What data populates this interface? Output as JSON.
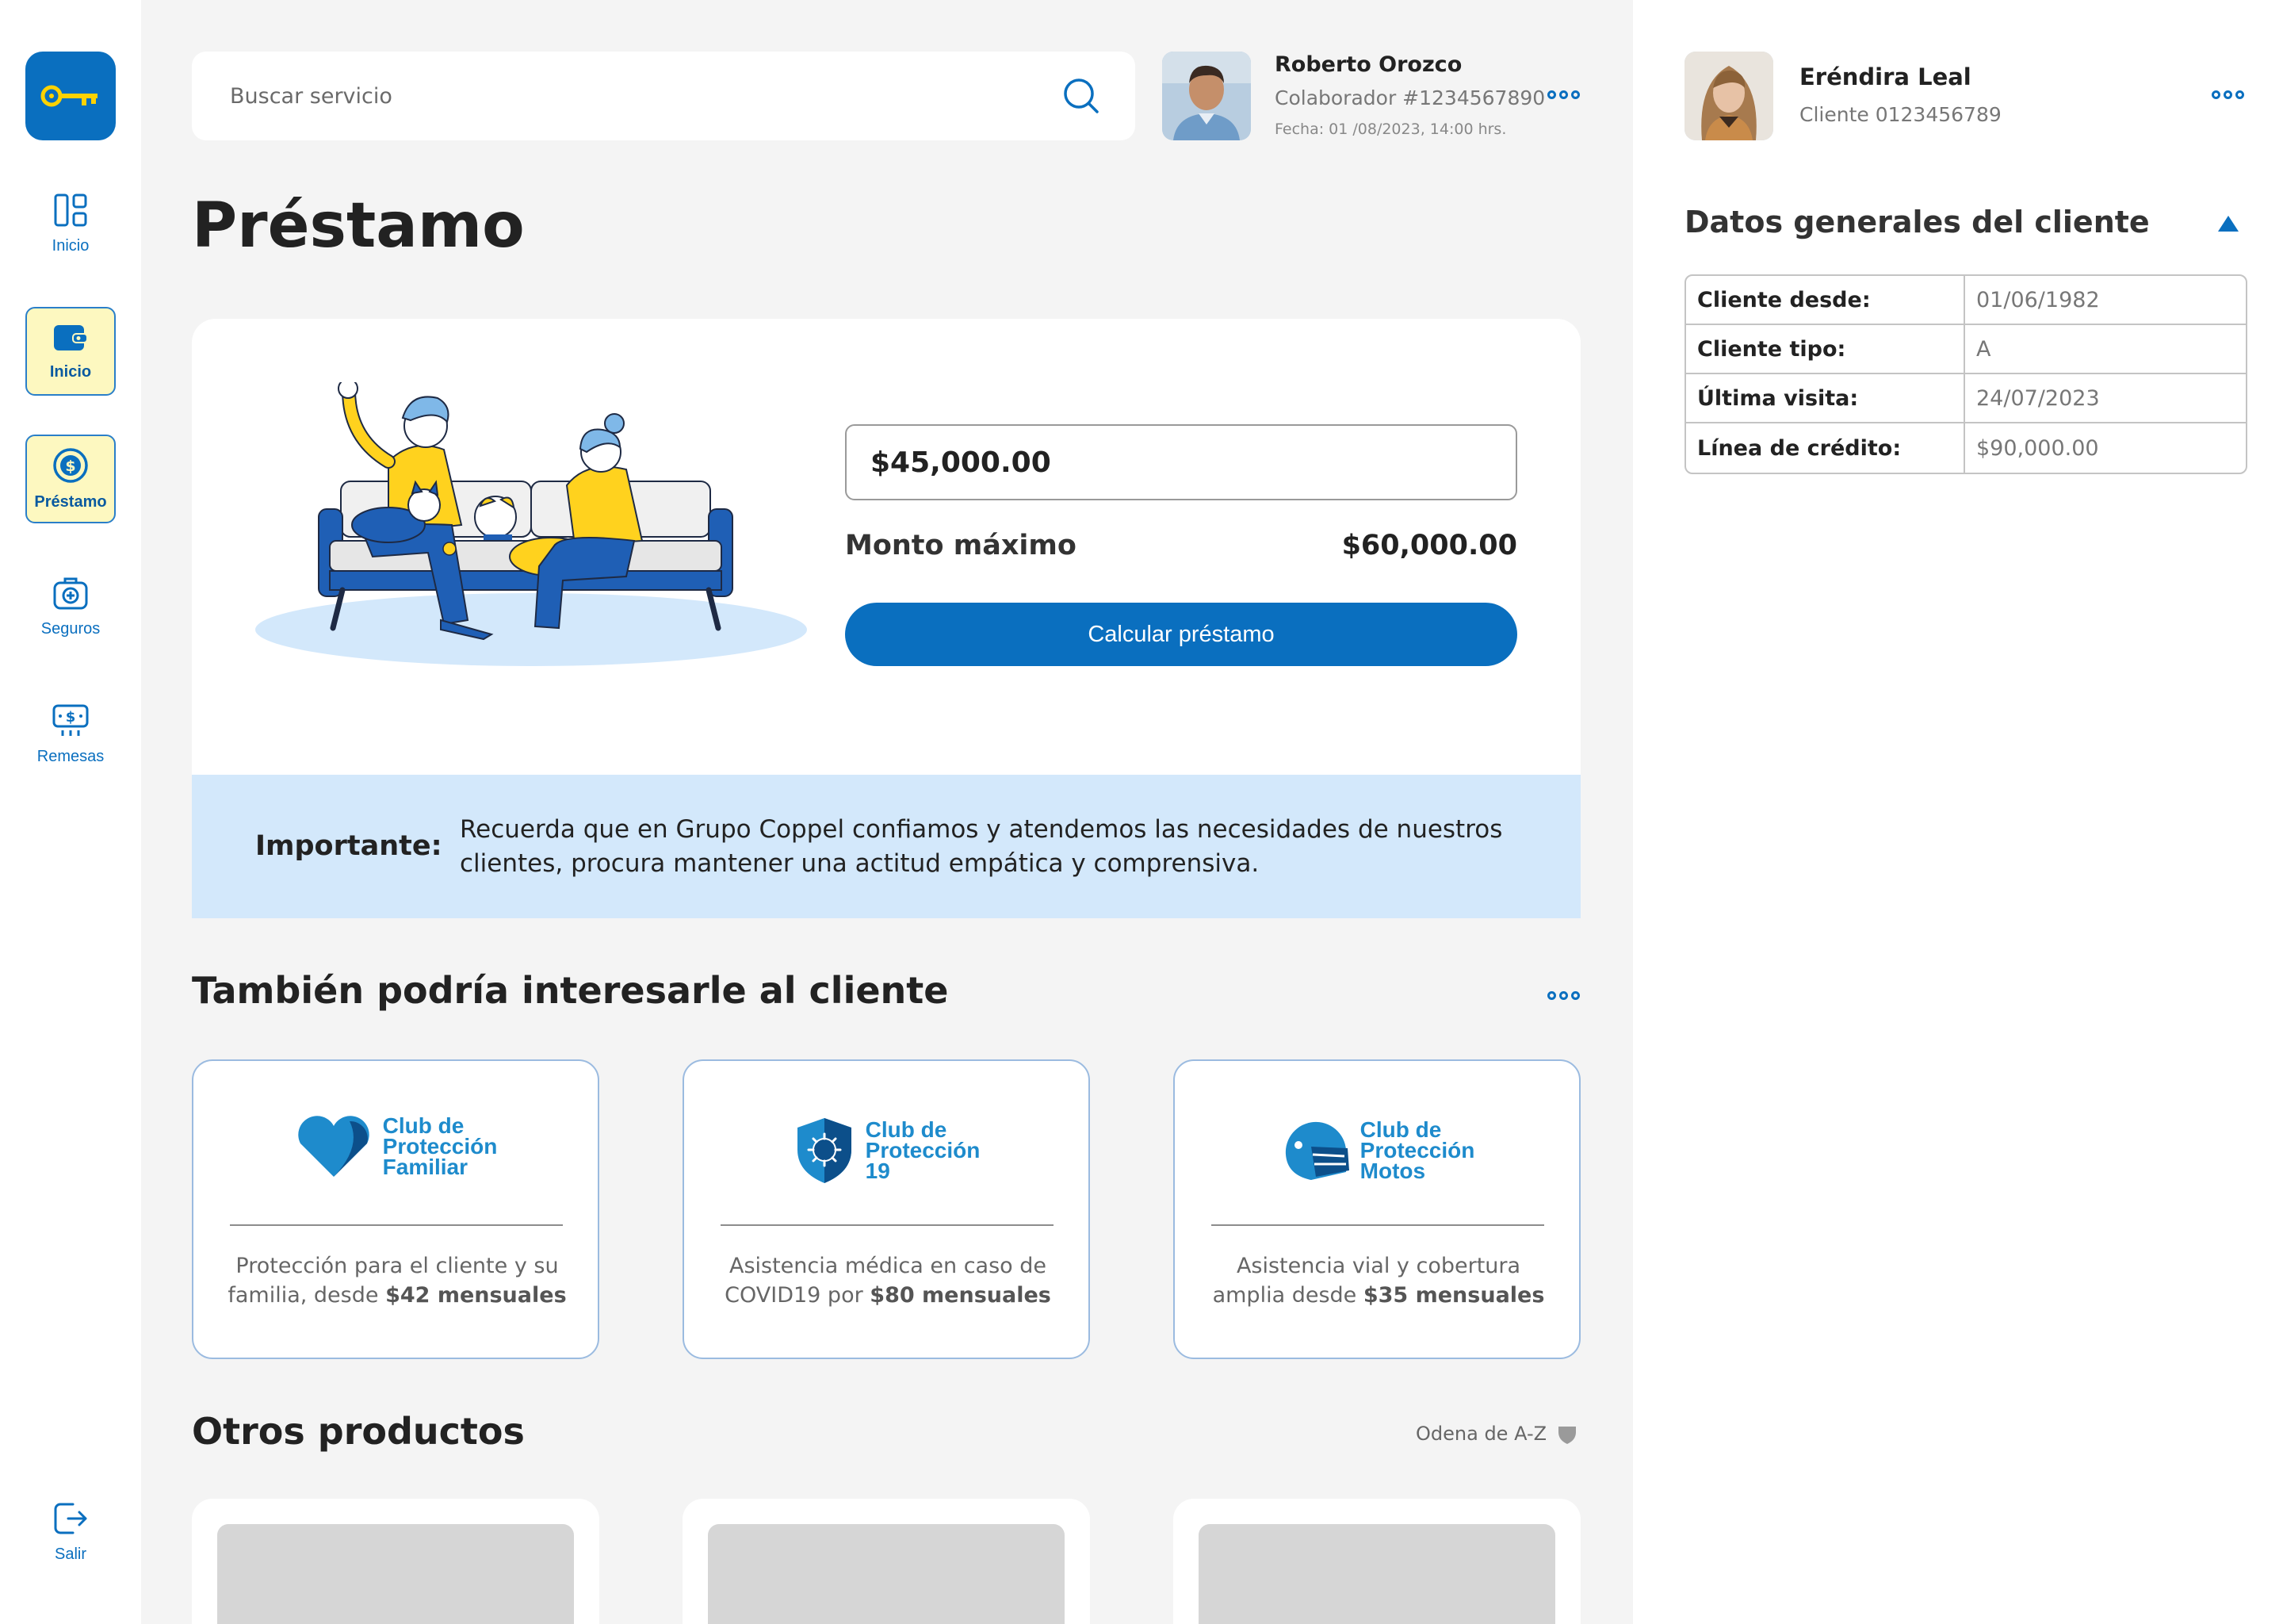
{
  "colors": {
    "brand_blue": "#0a6fbf",
    "active_yellow": "#fdf8c0",
    "key_yellow": "#ffd200",
    "notice_blue": "#d3e8fb"
  },
  "sidebar": {
    "logo_icon": "key-icon",
    "items": [
      {
        "label": "Inicio",
        "icon": "dashboard-icon",
        "active": false
      },
      {
        "label": "Inicio",
        "icon": "wallet-icon",
        "active": true
      },
      {
        "label": "Préstamo",
        "icon": "dollar-coin-icon",
        "active": true
      },
      {
        "label": "Seguros",
        "icon": "medical-case-icon",
        "active": false
      },
      {
        "label": "Remesas",
        "icon": "money-transfer-icon",
        "active": false
      }
    ],
    "logout_label": "Salir"
  },
  "search": {
    "placeholder": "Buscar servicio"
  },
  "collaborator": {
    "name": "Roberto Orozco",
    "id": "Colaborador #1234567890",
    "date": "Fecha: 01 /08/2023, 14:00 hrs."
  },
  "page": {
    "title": "Préstamo"
  },
  "loan": {
    "amount_value": "$45,000.00",
    "max_label": "Monto máximo",
    "max_value": "$60,000.00",
    "calc_button": "Calcular préstamo"
  },
  "notice": {
    "label": "Importante:",
    "text": "Recuerda que en Grupo Coppel confiamos y atendemos las necesidades de nuestros clientes, procura mantener una actitud empática y comprensiva."
  },
  "recommendations": {
    "title": "También podría interesarle al cliente",
    "cards": [
      {
        "logo_text": "Club de\nProtección\nFamiliar",
        "icon": "heart-icon",
        "desc_pre": "Protección para el cliente y su familia, desde ",
        "desc_bold": "$42 mensuales"
      },
      {
        "logo_text": "Club de\nProtección\n19",
        "icon": "shield-virus-icon",
        "desc_pre": "Asistencia médica en caso de COVID19 por ",
        "desc_bold": "$80 mensuales"
      },
      {
        "logo_text": "Club de\nProtección\nMotos",
        "icon": "helmet-icon",
        "desc_pre": "Asistencia vial y cobertura amplia desde ",
        "desc_bold": "$35 mensuales"
      }
    ]
  },
  "other_products": {
    "title": "Otros productos",
    "sort_label": "Odena de A-Z"
  },
  "client": {
    "name": "Eréndira Leal",
    "id": "Cliente 0123456789",
    "panel_title": "Datos generales del cliente",
    "rows": [
      {
        "key": "Cliente desde:",
        "value": "01/06/1982"
      },
      {
        "key": "Cliente tipo:",
        "value": "A"
      },
      {
        "key": "Última visita:",
        "value": "24/07/2023"
      },
      {
        "key": "Línea de crédito:",
        "value": "$90,000.00"
      }
    ]
  }
}
